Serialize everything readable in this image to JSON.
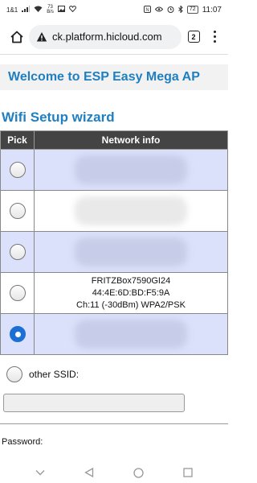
{
  "status_bar": {
    "carrier": "1&1",
    "speed_value": "73",
    "speed_unit": "B/s",
    "battery": "72",
    "time": "11:07"
  },
  "browser": {
    "url": "ck.platform.hicloud.com",
    "tab_count": "2"
  },
  "page": {
    "banner_title": "Welcome to ESP Easy Mega AP",
    "section_title": "Wifi Setup wizard",
    "table": {
      "headers": [
        "Pick",
        "Network info"
      ],
      "visible_network": {
        "ssid": "FRITZBox7590GI24",
        "bssid": "44:4E:6D:BD:F5:9A",
        "details": "Ch:11 (-30dBm) WPA2/PSK"
      }
    },
    "other_ssid_label": "other SSID:",
    "password_label": "Password:"
  }
}
